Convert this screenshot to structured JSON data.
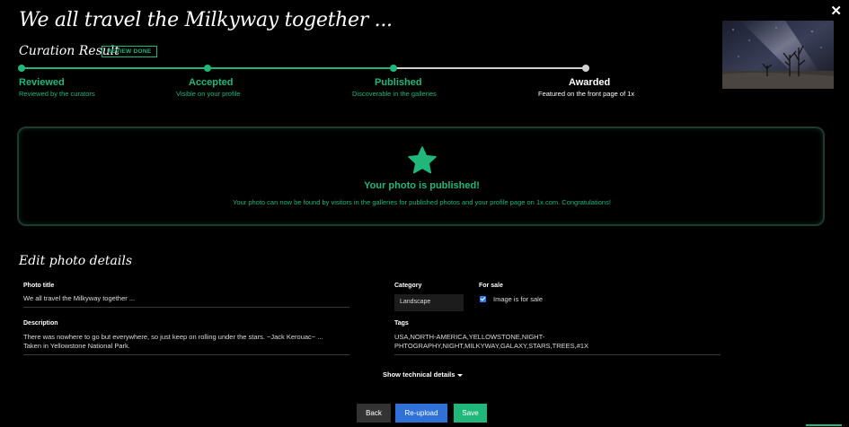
{
  "photo": {
    "title": "We all travel the Milkyway together ..."
  },
  "curation": {
    "heading": "Curation Result",
    "badge": "REVIEW DONE",
    "steps": [
      {
        "label": "Reviewed",
        "sub": "Reviewed by the curators",
        "state": "done"
      },
      {
        "label": "Accepted",
        "sub": "Visible on your profile",
        "state": "done"
      },
      {
        "label": "Published",
        "sub": "Discoverable in the galleries",
        "state": "done"
      },
      {
        "label": "Awarded",
        "sub": "Featured on the front page of 1x",
        "state": "pending"
      }
    ]
  },
  "published": {
    "title": "Your photo is published!",
    "message": "Your photo can now be found by visitors in the galleries for published photos and your profile page on 1x.com. Congratulations!"
  },
  "edit": {
    "heading": "Edit photo details",
    "photo_title_label": "Photo title",
    "photo_title_value": "We all travel the Milkyway together ...",
    "description_label": "Description",
    "description_value_1": "There was nowhere to go but everywhere, so just keep on rolling under the stars. ~Jack Kerouac~ ...",
    "description_value_2": "Taken in Yellowstone National Park.",
    "category_label": "Category",
    "category_value": "Landscape",
    "for_sale_label": "For sale",
    "for_sale_checkbox_label": "Image is for sale",
    "for_sale_checked": true,
    "tags_label": "Tags",
    "tags_value_1": "USA,NORTH-AMERICA,YELLOWSTONE,NIGHT-",
    "tags_value_2": "PHTOGRAPHY,NIGHT,MILKYWAY,GALAXY,STARS,TREES,#1X",
    "technical_toggle": "Show technical details"
  },
  "buttons": {
    "back": "Back",
    "reupload": "Re-upload",
    "save": "Save"
  },
  "icons": {
    "close": "close-icon",
    "star": "star-icon",
    "caret": "caret-down-icon"
  },
  "colors": {
    "accent": "#21b77a",
    "reupload": "#2f71d6",
    "pending": "#cfcfcf"
  }
}
